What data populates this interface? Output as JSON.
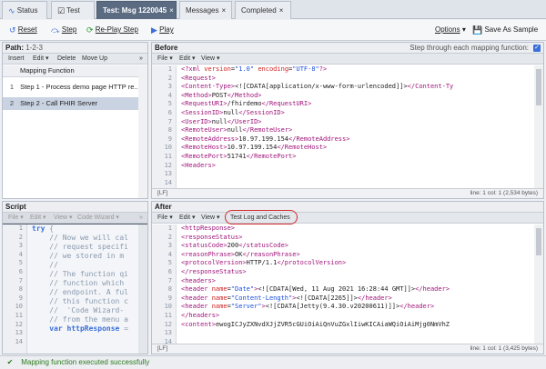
{
  "tabs": [
    {
      "label": "Status",
      "icon": "activity-icon"
    },
    {
      "label": "Test",
      "icon": "checkbox-icon"
    },
    {
      "label": "Test: Msg 1220045",
      "close": "×"
    },
    {
      "label": "Messages",
      "close": "×"
    },
    {
      "label": "Completed",
      "close": "×"
    }
  ],
  "toolbar": {
    "reset": "Reset",
    "step": "Step",
    "replay": "Re-Play Step",
    "play": "Play",
    "options": "Options",
    "options_arrow": "▾",
    "save_sample": "Save As Sample"
  },
  "path_pane": {
    "title": "Path:",
    "path_value": "1-2-3",
    "menu": [
      "Insert",
      "Edit ▾",
      "Delete",
      "Move Up"
    ],
    "menu_more": "»",
    "header": "Mapping Function",
    "rows": [
      {
        "num": "1",
        "label": "Step 1 - Process demo page HTTP re..."
      },
      {
        "num": "2",
        "label": "Step 2 - Call FHIR Server"
      }
    ]
  },
  "before_pane": {
    "title": "Before",
    "step_through_label": "Step through each mapping function:",
    "menu": [
      "File ▾",
      "Edit ▾",
      "View ▾"
    ],
    "line_numbers": [
      "1",
      "2",
      "3",
      "4",
      "5",
      "6",
      "7",
      "8",
      "9",
      "10",
      "11",
      "12",
      "13",
      "14"
    ],
    "lines": [
      [
        {
          "c": "tg",
          "t": "<?xml "
        },
        {
          "c": "at",
          "t": "version"
        },
        {
          "c": "tx",
          "t": "="
        },
        {
          "c": "av",
          "t": "\"1.0\" "
        },
        {
          "c": "at",
          "t": "encoding"
        },
        {
          "c": "tx",
          "t": "="
        },
        {
          "c": "av",
          "t": "\"UTF-8\""
        },
        {
          "c": "tg",
          "t": "?>"
        }
      ],
      [
        {
          "c": "tg",
          "t": "<Request>"
        }
      ],
      [
        {
          "c": "tg",
          "t": "<Content-Type>"
        },
        {
          "c": "tx",
          "t": "<![CDATA[application/x-www-form-urlencoded]]>"
        },
        {
          "c": "tg",
          "t": "</Content-Ty"
        }
      ],
      [
        {
          "c": "tg",
          "t": "<Method>"
        },
        {
          "c": "tx",
          "t": "POST"
        },
        {
          "c": "tg",
          "t": "</Method>"
        }
      ],
      [
        {
          "c": "tg",
          "t": "<RequestURI>"
        },
        {
          "c": "tx",
          "t": "/fhirdemo"
        },
        {
          "c": "tg",
          "t": "</RequestURI>"
        }
      ],
      [
        {
          "c": "tg",
          "t": "<SessionID>"
        },
        {
          "c": "tx",
          "t": "null"
        },
        {
          "c": "tg",
          "t": "</SessionID>"
        }
      ],
      [
        {
          "c": "tg",
          "t": "<UserID>"
        },
        {
          "c": "tx",
          "t": "null"
        },
        {
          "c": "tg",
          "t": "</UserID>"
        }
      ],
      [
        {
          "c": "tg",
          "t": "<RemoteUser>"
        },
        {
          "c": "tx",
          "t": "null"
        },
        {
          "c": "tg",
          "t": "</RemoteUser>"
        }
      ],
      [
        {
          "c": "tg",
          "t": "<RemoteAddress>"
        },
        {
          "c": "tx",
          "t": "10.97.199.154"
        },
        {
          "c": "tg",
          "t": "</RemoteAddress>"
        }
      ],
      [
        {
          "c": "tg",
          "t": "<RemoteHost>"
        },
        {
          "c": "tx",
          "t": "10.97.199.154"
        },
        {
          "c": "tg",
          "t": "</RemoteHost>"
        }
      ],
      [
        {
          "c": "tg",
          "t": "<RemotePort>"
        },
        {
          "c": "tx",
          "t": "51741"
        },
        {
          "c": "tg",
          "t": "</RemotePort>"
        }
      ],
      [
        {
          "c": "tg",
          "t": "<Headers>"
        }
      ],
      [
        {
          "c": "tx",
          "t": ""
        }
      ],
      [
        {
          "c": "tx",
          "t": ""
        }
      ]
    ],
    "footer_left": "[LF]",
    "footer_right": "line: 1 col: 1 (2,534 bytes)"
  },
  "script_pane": {
    "title": "Script",
    "menu": [
      "File ▾",
      "Edit ▾",
      "View ▾",
      "Code Wizard ▾"
    ],
    "menu_more": "»",
    "line_numbers": [
      "1",
      "2",
      "3",
      "4",
      "5",
      "6",
      "7",
      "8",
      "9",
      "10",
      "11",
      "12",
      "13",
      "14"
    ],
    "lines": [
      [
        {
          "c": "kw",
          "t": "try"
        },
        {
          "c": "cm",
          "t": " {"
        }
      ],
      [
        {
          "c": "cm",
          "t": "    // Now we will cal"
        }
      ],
      [
        {
          "c": "cm",
          "t": "    // request specifi"
        }
      ],
      [
        {
          "c": "cm",
          "t": "    // we stored in m"
        }
      ],
      [
        {
          "c": "cm",
          "t": "    //"
        }
      ],
      [
        {
          "c": "cm",
          "t": "    // The function qi"
        }
      ],
      [
        {
          "c": "cm",
          "t": "    // function which "
        }
      ],
      [
        {
          "c": "cm",
          "t": "    // endpoint. A ful"
        }
      ],
      [
        {
          "c": "cm",
          "t": "    // this function c"
        }
      ],
      [
        {
          "c": "cm",
          "t": "    //  'Code Wizard-"
        }
      ],
      [
        {
          "c": "cm",
          "t": "    // from the menu a"
        }
      ],
      [
        {
          "c": "kw",
          "t": "    var "
        },
        {
          "c": "kw",
          "t": "httpResponse"
        },
        {
          "c": "cm",
          "t": " ="
        }
      ],
      [
        {
          "c": "cm",
          "t": ""
        }
      ],
      [
        {
          "c": "cm",
          "t": ""
        }
      ]
    ]
  },
  "after_pane": {
    "title": "After",
    "menu": [
      "File ▾",
      "Edit ▾",
      "View ▾",
      "Test Log and Caches"
    ],
    "line_numbers": [
      "1",
      "2",
      "3",
      "4",
      "5",
      "6",
      "7",
      "8",
      "9",
      "10",
      "11",
      "12",
      "13",
      "14"
    ],
    "lines": [
      [
        {
          "c": "tg",
          "t": "<httpResponse>"
        }
      ],
      [
        {
          "c": "tg",
          "t": "<responseStatus>"
        }
      ],
      [
        {
          "c": "tg",
          "t": "<statusCode>"
        },
        {
          "c": "tx",
          "t": "200"
        },
        {
          "c": "tg",
          "t": "</statusCode>"
        }
      ],
      [
        {
          "c": "tg",
          "t": "<reasonPhrase>"
        },
        {
          "c": "tx",
          "t": "OK"
        },
        {
          "c": "tg",
          "t": "</reasonPhrase>"
        }
      ],
      [
        {
          "c": "tg",
          "t": "<protocolVersion>"
        },
        {
          "c": "tx",
          "t": "HTTP/1.1"
        },
        {
          "c": "tg",
          "t": "</protocolVersion>"
        }
      ],
      [
        {
          "c": "tg",
          "t": "</responseStatus>"
        }
      ],
      [
        {
          "c": "tg",
          "t": "<headers>"
        }
      ],
      [
        {
          "c": "tg",
          "t": "<header "
        },
        {
          "c": "at",
          "t": "name"
        },
        {
          "c": "tx",
          "t": "="
        },
        {
          "c": "av",
          "t": "\"Date\""
        },
        {
          "c": "tg",
          "t": ">"
        },
        {
          "c": "tx",
          "t": "<![CDATA[Wed, 11 Aug 2021 16:28:44 GMT]]>"
        },
        {
          "c": "tg",
          "t": "</header>"
        }
      ],
      [
        {
          "c": "tg",
          "t": "<header "
        },
        {
          "c": "at",
          "t": "name"
        },
        {
          "c": "tx",
          "t": "="
        },
        {
          "c": "av",
          "t": "\"Content-Length\""
        },
        {
          "c": "tg",
          "t": ">"
        },
        {
          "c": "tx",
          "t": "<![CDATA[2265]]>"
        },
        {
          "c": "tg",
          "t": "</header>"
        }
      ],
      [
        {
          "c": "tg",
          "t": "<header "
        },
        {
          "c": "at",
          "t": "name"
        },
        {
          "c": "tx",
          "t": "="
        },
        {
          "c": "av",
          "t": "\"Server\""
        },
        {
          "c": "tg",
          "t": ">"
        },
        {
          "c": "tx",
          "t": "<![CDATA[Jetty(9.4.30.v20200611)]]>"
        },
        {
          "c": "tg",
          "t": "</header>"
        }
      ],
      [
        {
          "c": "tg",
          "t": "</headers>"
        }
      ],
      [
        {
          "c": "tg",
          "t": "<content>"
        },
        {
          "c": "tx",
          "t": "ewogICJyZXNvdXJjZVR5cGUiOiAiQnVuZGxlIiwKICAiaWQiOiAiMjg0NmVhZ"
        }
      ],
      [
        {
          "c": "tx",
          "t": ""
        }
      ],
      [
        {
          "c": "tx",
          "t": ""
        }
      ]
    ],
    "footer_left": "[LF]",
    "footer_right": "line: 1 col: 1 (3,425 bytes)"
  },
  "status_bar": {
    "text": "Mapping function executed successfully",
    "icon": "check-icon"
  },
  "colors": {
    "active_tab": "#5a6b82",
    "xml_tag": "#a0147a",
    "xml_attr": "#d02020",
    "xml_value": "#1a4ee0",
    "success": "#2c7a1c",
    "highlight_circle": "#d42a2a"
  }
}
